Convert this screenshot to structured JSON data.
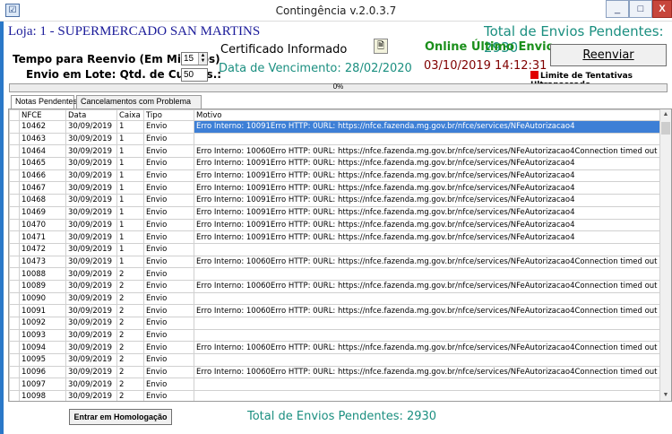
{
  "window": {
    "title": "Contingência   v.2.0.3.7",
    "min_label": "_",
    "max_label": "□",
    "close_label": "X",
    "app_icon": "☑"
  },
  "store": {
    "name": "Loja: 1 - SUPERMERCADO SAN MARTINS"
  },
  "total_top": "Total de Envios Pendentes: 2930",
  "settings": {
    "reenvio_label": "Tempo para Reenvio (Em Minutos)",
    "reenvio_value": "15",
    "lote_label": "Envio em Lote: Qtd. de Cupons.:",
    "lote_value": "50"
  },
  "certificate": {
    "status": "Certificado Informado",
    "expiry": "Data de Vencimento: 28/02/2020",
    "button_icon": "certificate-icon"
  },
  "online": {
    "label": "Online Último Envio",
    "datetime": "03/10/2019 14:12:31"
  },
  "reenviar_label": "Reenviar",
  "limite_label": "Limite de Tentativas Ultrapassado",
  "colors": {
    "accent_teal": "#1b8f80",
    "online_green": "#1b8f1b",
    "datetime_maroon": "#800000",
    "store_blue": "#1a1a99",
    "limit_red": "#e00000",
    "selection": "#3d7fd6"
  },
  "progress": {
    "value": 0,
    "label": "0%"
  },
  "tabs": [
    {
      "label": "Notas Pendentes"
    },
    {
      "label": "Cancelamentos com Problema"
    }
  ],
  "grid": {
    "columns": [
      "NFCE",
      "Data",
      "Caixa",
      "Tipo",
      "Motivo"
    ],
    "rows": [
      {
        "nfce": "10462",
        "data": "30/09/2019",
        "caixa": "1",
        "tipo": "Envio",
        "motivo": "Erro Interno: 10091Erro HTTP: 0URL: https://nfce.fazenda.mg.gov.br/nfce/services/NFeAutorizacao4",
        "selected": true
      },
      {
        "nfce": "10463",
        "data": "30/09/2019",
        "caixa": "1",
        "tipo": "Envio",
        "motivo": ""
      },
      {
        "nfce": "10464",
        "data": "30/09/2019",
        "caixa": "1",
        "tipo": "Envio",
        "motivo": "Erro Interno: 10060Erro HTTP: 0URL: https://nfce.fazenda.mg.gov.br/nfce/services/NFeAutorizacao4Connection timed out"
      },
      {
        "nfce": "10465",
        "data": "30/09/2019",
        "caixa": "1",
        "tipo": "Envio",
        "motivo": "Erro Interno: 10091Erro HTTP: 0URL: https://nfce.fazenda.mg.gov.br/nfce/services/NFeAutorizacao4"
      },
      {
        "nfce": "10466",
        "data": "30/09/2019",
        "caixa": "1",
        "tipo": "Envio",
        "motivo": "Erro Interno: 10091Erro HTTP: 0URL: https://nfce.fazenda.mg.gov.br/nfce/services/NFeAutorizacao4"
      },
      {
        "nfce": "10467",
        "data": "30/09/2019",
        "caixa": "1",
        "tipo": "Envio",
        "motivo": "Erro Interno: 10091Erro HTTP: 0URL: https://nfce.fazenda.mg.gov.br/nfce/services/NFeAutorizacao4"
      },
      {
        "nfce": "10468",
        "data": "30/09/2019",
        "caixa": "1",
        "tipo": "Envio",
        "motivo": "Erro Interno: 10091Erro HTTP: 0URL: https://nfce.fazenda.mg.gov.br/nfce/services/NFeAutorizacao4"
      },
      {
        "nfce": "10469",
        "data": "30/09/2019",
        "caixa": "1",
        "tipo": "Envio",
        "motivo": "Erro Interno: 10091Erro HTTP: 0URL: https://nfce.fazenda.mg.gov.br/nfce/services/NFeAutorizacao4"
      },
      {
        "nfce": "10470",
        "data": "30/09/2019",
        "caixa": "1",
        "tipo": "Envio",
        "motivo": "Erro Interno: 10091Erro HTTP: 0URL: https://nfce.fazenda.mg.gov.br/nfce/services/NFeAutorizacao4"
      },
      {
        "nfce": "10471",
        "data": "30/09/2019",
        "caixa": "1",
        "tipo": "Envio",
        "motivo": "Erro Interno: 10091Erro HTTP: 0URL: https://nfce.fazenda.mg.gov.br/nfce/services/NFeAutorizacao4"
      },
      {
        "nfce": "10472",
        "data": "30/09/2019",
        "caixa": "1",
        "tipo": "Envio",
        "motivo": ""
      },
      {
        "nfce": "10473",
        "data": "30/09/2019",
        "caixa": "1",
        "tipo": "Envio",
        "motivo": "Erro Interno: 10060Erro HTTP: 0URL: https://nfce.fazenda.mg.gov.br/nfce/services/NFeAutorizacao4Connection timed out"
      },
      {
        "nfce": "10088",
        "data": "30/09/2019",
        "caixa": "2",
        "tipo": "Envio",
        "motivo": ""
      },
      {
        "nfce": "10089",
        "data": "30/09/2019",
        "caixa": "2",
        "tipo": "Envio",
        "motivo": "Erro Interno: 10060Erro HTTP: 0URL: https://nfce.fazenda.mg.gov.br/nfce/services/NFeAutorizacao4Connection timed out"
      },
      {
        "nfce": "10090",
        "data": "30/09/2019",
        "caixa": "2",
        "tipo": "Envio",
        "motivo": ""
      },
      {
        "nfce": "10091",
        "data": "30/09/2019",
        "caixa": "2",
        "tipo": "Envio",
        "motivo": "Erro Interno: 10060Erro HTTP: 0URL: https://nfce.fazenda.mg.gov.br/nfce/services/NFeAutorizacao4Connection timed out"
      },
      {
        "nfce": "10092",
        "data": "30/09/2019",
        "caixa": "2",
        "tipo": "Envio",
        "motivo": ""
      },
      {
        "nfce": "10093",
        "data": "30/09/2019",
        "caixa": "2",
        "tipo": "Envio",
        "motivo": ""
      },
      {
        "nfce": "10094",
        "data": "30/09/2019",
        "caixa": "2",
        "tipo": "Envio",
        "motivo": "Erro Interno: 10060Erro HTTP: 0URL: https://nfce.fazenda.mg.gov.br/nfce/services/NFeAutorizacao4Connection timed out"
      },
      {
        "nfce": "10095",
        "data": "30/09/2019",
        "caixa": "2",
        "tipo": "Envio",
        "motivo": ""
      },
      {
        "nfce": "10096",
        "data": "30/09/2019",
        "caixa": "2",
        "tipo": "Envio",
        "motivo": "Erro Interno: 10060Erro HTTP: 0URL: https://nfce.fazenda.mg.gov.br/nfce/services/NFeAutorizacao4Connection timed out"
      },
      {
        "nfce": "10097",
        "data": "30/09/2019",
        "caixa": "2",
        "tipo": "Envio",
        "motivo": ""
      },
      {
        "nfce": "10098",
        "data": "30/09/2019",
        "caixa": "2",
        "tipo": "Envio",
        "motivo": ""
      }
    ]
  },
  "homologacao_label": "Entrar em Homologação",
  "total_bottom": "Total de Envios Pendentes: 2930"
}
